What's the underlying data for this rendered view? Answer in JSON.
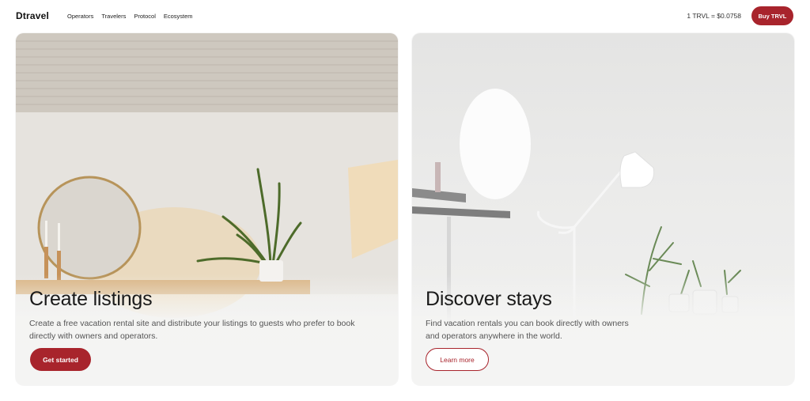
{
  "nav": {
    "logo": "Dtravel",
    "links": [
      "Operators",
      "Travelers",
      "Protocol",
      "Ecosystem"
    ],
    "rate": "1 TRVL = $0.0758",
    "buy_label": "Buy TRVL"
  },
  "cards": [
    {
      "title": "Create listings",
      "text": "Create a free vacation rental site and distribute your listings to guests who prefer to book directly with owners and operators.",
      "button": "Get started"
    },
    {
      "title": "Discover stays",
      "text": "Find vacation rentals you can book directly with owners and operators anywhere in the world.",
      "button": "Learn more"
    }
  ],
  "colors": {
    "accent": "#a8242c"
  }
}
